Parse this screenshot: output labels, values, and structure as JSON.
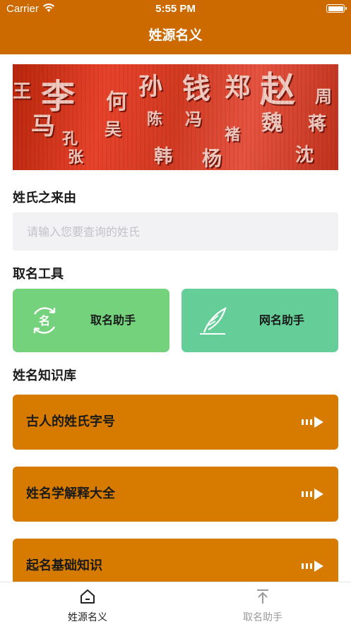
{
  "status_bar": {
    "carrier": "Carrier",
    "time": "5:55 PM"
  },
  "nav": {
    "title": "姓源名义"
  },
  "banner": {
    "tiles": [
      "李",
      "何",
      "孙",
      "钱",
      "郑",
      "赵",
      "周",
      "马",
      "吴",
      "陈",
      "孔",
      "冯",
      "魏",
      "褚",
      "蒋",
      "沈",
      "韩",
      "杨",
      "张",
      "王"
    ]
  },
  "origin_section": {
    "title": "姓氏之来由",
    "search_placeholder": "请输入您要查询的姓氏",
    "search_value": ""
  },
  "tools_section": {
    "title": "取名工具",
    "cards": [
      {
        "label": "取名助手",
        "icon": "name-refresh-icon",
        "color": "#74d27c"
      },
      {
        "label": "网名助手",
        "icon": "feather-icon",
        "color": "#64cd98"
      }
    ]
  },
  "kb_section": {
    "title": "姓名知识库",
    "items": [
      {
        "label": "古人的姓氏字号"
      },
      {
        "label": "姓名学解释大全"
      },
      {
        "label": "起名基础知识"
      }
    ]
  },
  "tab_bar": {
    "tabs": [
      {
        "label": "姓源名义",
        "icon": "home-icon",
        "active": true
      },
      {
        "label": "取名助手",
        "icon": "upload-icon",
        "active": false
      }
    ]
  },
  "colors": {
    "brand": "#cc6a00",
    "card": "#d67b00",
    "green": "#74d27c",
    "teal": "#64cd98"
  }
}
